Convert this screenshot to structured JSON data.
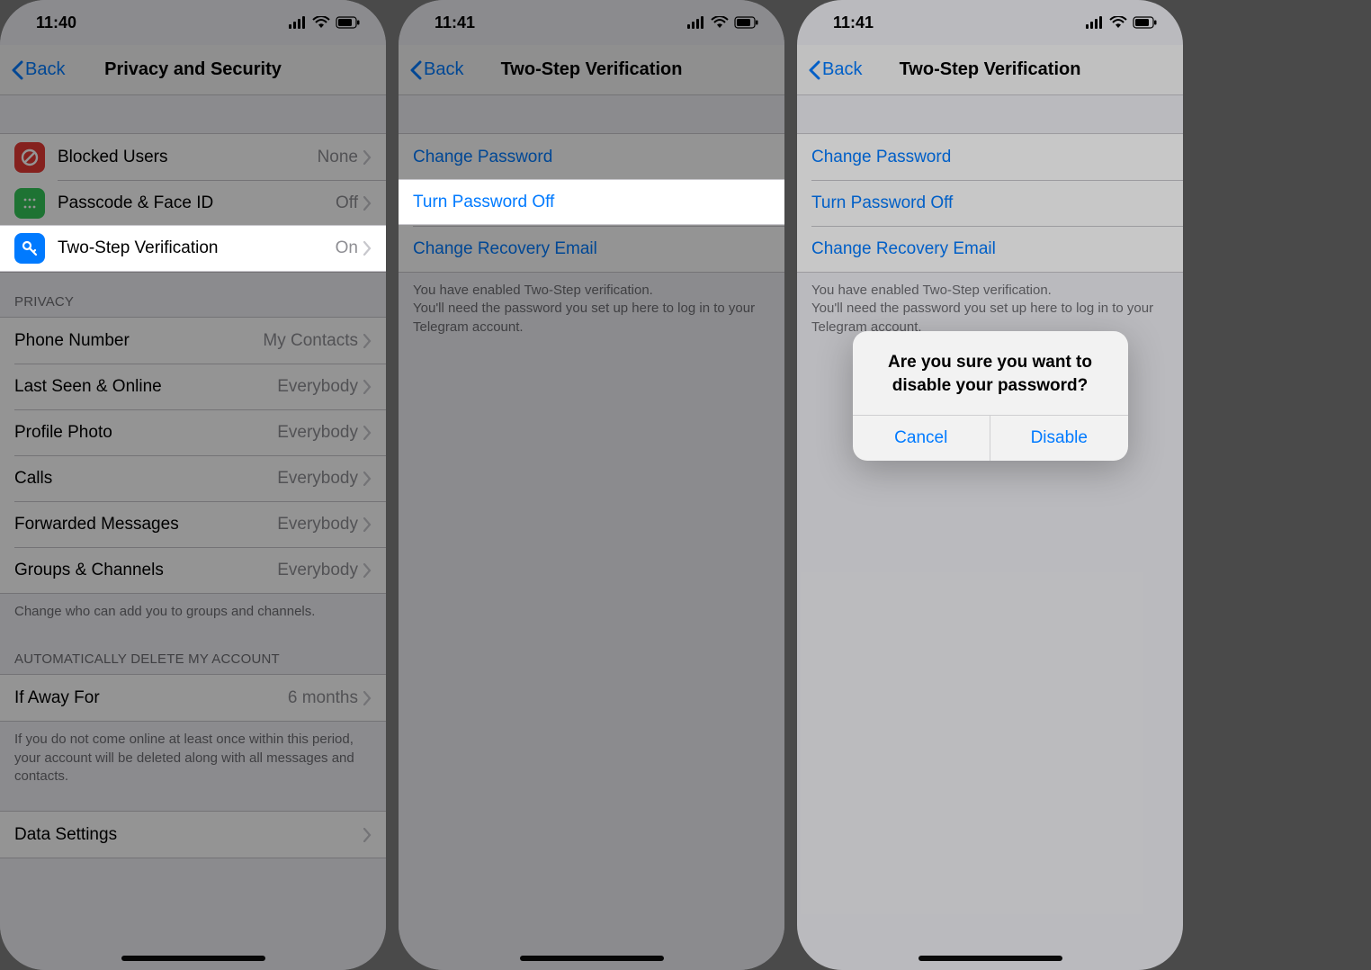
{
  "statusbar": {
    "time1": "11:40",
    "time2": "11:41",
    "time3": "11:41"
  },
  "screen1": {
    "back": "Back",
    "title": "Privacy and Security",
    "rows": {
      "blocked": {
        "label": "Blocked Users",
        "value": "None"
      },
      "passcode": {
        "label": "Passcode & Face ID",
        "value": "Off"
      },
      "twostep": {
        "label": "Two-Step Verification",
        "value": "On"
      }
    },
    "privacy_header": "Privacy",
    "privacy_rows": {
      "phone": {
        "label": "Phone Number",
        "value": "My Contacts"
      },
      "lastseen": {
        "label": "Last Seen & Online",
        "value": "Everybody"
      },
      "photo": {
        "label": "Profile Photo",
        "value": "Everybody"
      },
      "calls": {
        "label": "Calls",
        "value": "Everybody"
      },
      "forwarded": {
        "label": "Forwarded Messages",
        "value": "Everybody"
      },
      "groups": {
        "label": "Groups & Channels",
        "value": "Everybody"
      }
    },
    "privacy_footer": "Change who can add you to groups and channels.",
    "delete_header": "Automatically Delete My Account",
    "delete_row": {
      "label": "If Away For",
      "value": "6 months"
    },
    "delete_footer": "If you do not come online at least once within this period, your account will be deleted along with all messages and contacts.",
    "data_settings": "Data Settings"
  },
  "screen2": {
    "back": "Back",
    "title": "Two-Step Verification",
    "rows": {
      "change_pw": "Change Password",
      "turn_off": "Turn Password Off",
      "change_email": "Change Recovery Email"
    },
    "footer": "You have enabled Two-Step verification.\nYou'll need the password you set up here to log in to your Telegram account."
  },
  "alert": {
    "title": "Are you sure you want to disable your password?",
    "cancel": "Cancel",
    "disable": "Disable"
  }
}
